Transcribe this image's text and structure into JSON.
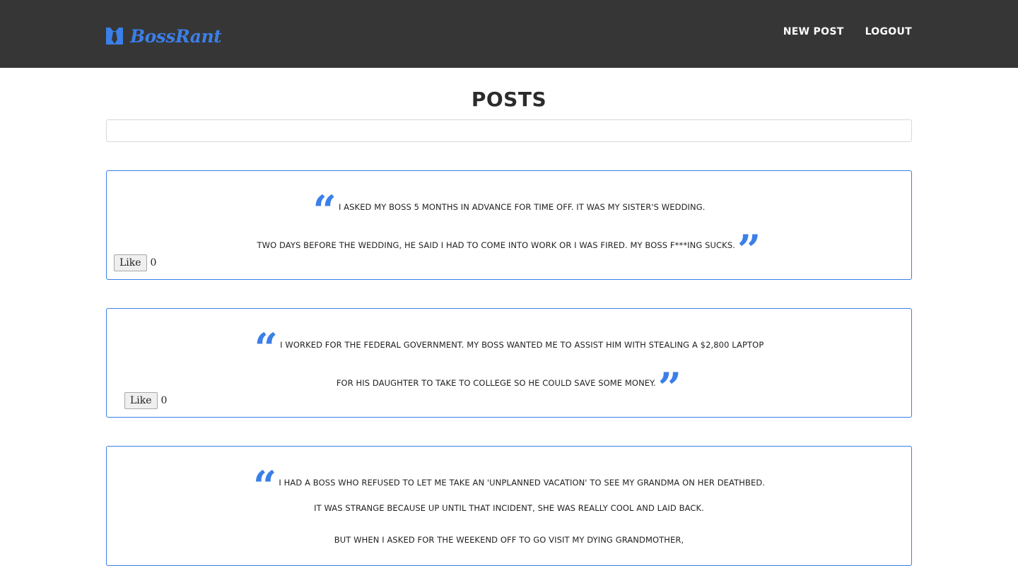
{
  "brand": {
    "name": "BossRant",
    "icon": "necktie-icon",
    "accent_color": "#3b7fe8"
  },
  "nav": {
    "new_post": "NEW POST",
    "logout": "LOGOUT"
  },
  "page": {
    "title": "POSTS",
    "search_value": ""
  },
  "like_label": "Like",
  "posts": [
    {
      "lines": [
        "I ASKED MY BOSS 5 MONTHS IN ADVANCE FOR TIME OFF. IT WAS MY SISTER'S WEDDING.",
        "TWO DAYS BEFORE THE WEDDING, HE SAID I HAD TO COME INTO WORK OR I WAS FIRED. MY BOSS F***ING SUCKS."
      ],
      "likes": "0"
    },
    {
      "lines": [
        "I WORKED FOR THE FEDERAL GOVERNMENT. MY BOSS WANTED ME TO ASSIST HIM WITH STEALING A $2,800 LAPTOP",
        "FOR HIS DAUGHTER TO TAKE TO COLLEGE SO HE COULD SAVE SOME MONEY."
      ],
      "likes": "0"
    },
    {
      "lines": [
        "I HAD A BOSS WHO REFUSED TO LET ME TAKE AN 'UNPLANNED VACATION' TO SEE MY GRANDMA ON HER DEATHBED.",
        "IT WAS STRANGE BECAUSE UP UNTIL THAT INCIDENT, SHE WAS REALLY COOL AND LAID BACK.",
        "BUT WHEN I ASKED FOR THE WEEKEND OFF TO GO VISIT MY DYING GRANDMOTHER,"
      ]
    }
  ]
}
